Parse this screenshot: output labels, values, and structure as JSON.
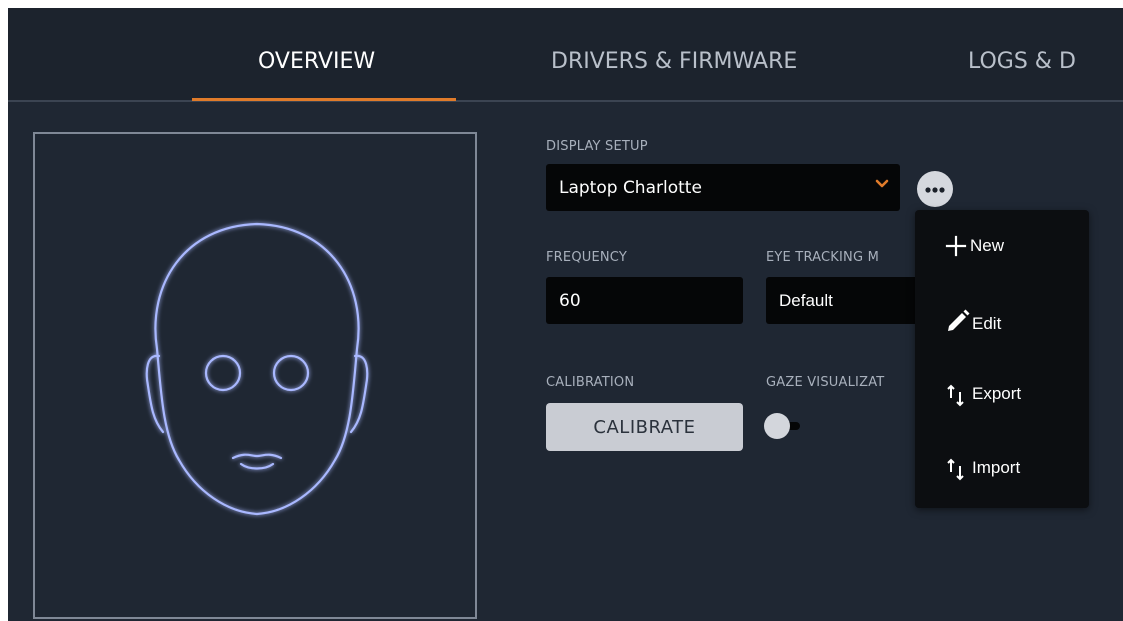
{
  "tabs": [
    {
      "label": "OVERVIEW",
      "active": true
    },
    {
      "label": "DRIVERS & FIRMWARE",
      "active": false
    },
    {
      "label": "LOGS & D",
      "active": false
    }
  ],
  "colors": {
    "accent": "#e07b2a",
    "background": "#1f2733",
    "face_outline": "#a9b8ff"
  },
  "display_setup": {
    "label": "DISPLAY SETUP",
    "value": "Laptop Charlotte"
  },
  "frequency": {
    "label": "FREQUENCY",
    "value": "60"
  },
  "eye_tracking_mode": {
    "label": "EYE TRACKING M",
    "value": "Default"
  },
  "calibration": {
    "label": "CALIBRATION",
    "button_label": "CALIBRATE"
  },
  "gaze_visualization": {
    "label": "GAZE VISUALIZAT",
    "enabled": false
  },
  "more_menu": {
    "icon": "more-horizontal-icon",
    "items": [
      {
        "label": "New",
        "icon": "plus-icon"
      },
      {
        "label": "Edit",
        "icon": "pencil-icon"
      },
      {
        "label": "Export",
        "icon": "sort-arrows-icon"
      },
      {
        "label": "Import",
        "icon": "sort-arrows-icon"
      }
    ]
  }
}
